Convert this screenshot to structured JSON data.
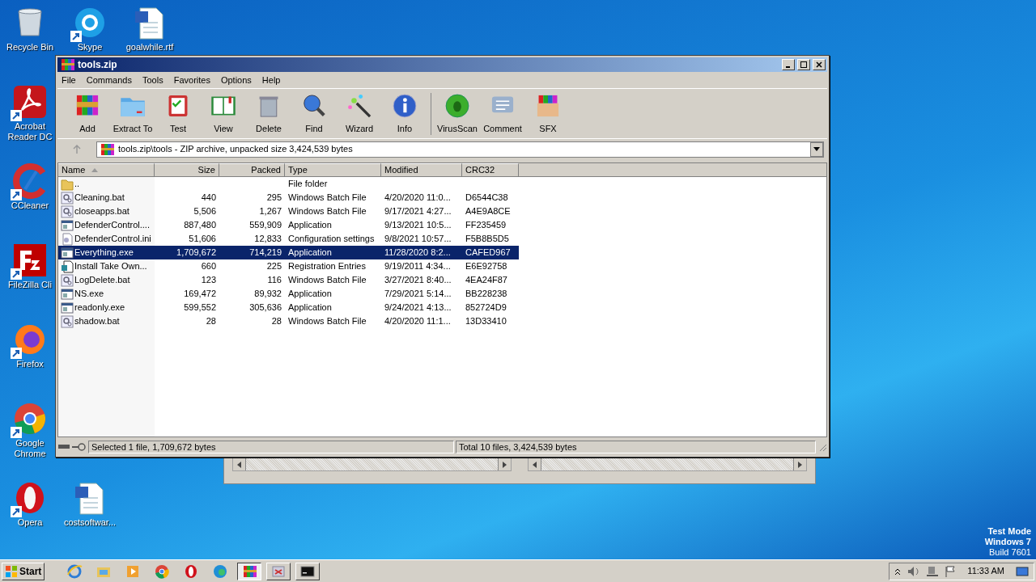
{
  "desktop_icons": [
    {
      "kind": "recycle",
      "label": "Recycle Bin",
      "shortcut": false
    },
    {
      "kind": "skype",
      "label": "Skype",
      "shortcut": true
    },
    {
      "kind": "word",
      "label": "goalwhile.rtf",
      "shortcut": false
    },
    {
      "kind": "acrobat",
      "label": "Acrobat Reader DC",
      "shortcut": true
    },
    {
      "kind": "ccleaner",
      "label": "CCleaner",
      "shortcut": true
    },
    {
      "kind": "filezilla",
      "label": "FileZilla Cli",
      "shortcut": true
    },
    {
      "kind": "firefox",
      "label": "Firefox",
      "shortcut": true
    },
    {
      "kind": "chrome",
      "label": "Google Chrome",
      "shortcut": true
    },
    {
      "kind": "opera",
      "label": "Opera",
      "shortcut": true
    },
    {
      "kind": "word",
      "label": "costsoftwar...",
      "shortcut": false
    }
  ],
  "window": {
    "title": "tools.zip",
    "menu": [
      "File",
      "Commands",
      "Tools",
      "Favorites",
      "Options",
      "Help"
    ],
    "toolbar": [
      {
        "kind": "add",
        "label": "Add"
      },
      {
        "kind": "extract",
        "label": "Extract To"
      },
      {
        "kind": "test",
        "label": "Test"
      },
      {
        "kind": "view",
        "label": "View"
      },
      {
        "kind": "delete",
        "label": "Delete"
      },
      {
        "kind": "find",
        "label": "Find"
      },
      {
        "kind": "wizard",
        "label": "Wizard"
      },
      {
        "kind": "info",
        "label": "Info"
      },
      {
        "kind": "virus",
        "label": "VirusScan"
      },
      {
        "kind": "comment",
        "label": "Comment"
      },
      {
        "kind": "sfx",
        "label": "SFX"
      }
    ],
    "address": "tools.zip\\tools - ZIP archive, unpacked size 3,424,539 bytes",
    "table": {
      "columns": [
        "Name",
        "Size",
        "Packed",
        "Type",
        "Modified",
        "CRC32"
      ],
      "rows": [
        {
          "kind": "folder",
          "name": "..",
          "size": "",
          "packed": "",
          "type": "File folder",
          "modified": "",
          "crc": "",
          "selected": false
        },
        {
          "kind": "bat",
          "name": "Cleaning.bat",
          "size": "440",
          "packed": "295",
          "type": "Windows Batch File",
          "modified": "4/20/2020 11:0...",
          "crc": "D6544C38",
          "selected": false
        },
        {
          "kind": "bat",
          "name": "closeapps.bat",
          "size": "5,506",
          "packed": "1,267",
          "type": "Windows Batch File",
          "modified": "9/17/2021 4:27...",
          "crc": "A4E9A8CE",
          "selected": false
        },
        {
          "kind": "exe",
          "name": "DefenderControl....",
          "size": "887,480",
          "packed": "559,909",
          "type": "Application",
          "modified": "9/13/2021 10:5...",
          "crc": "FF235459",
          "selected": false
        },
        {
          "kind": "ini",
          "name": "DefenderControl.ini",
          "size": "51,606",
          "packed": "12,833",
          "type": "Configuration settings",
          "modified": "9/8/2021 10:57...",
          "crc": "F5B8B5D5",
          "selected": false
        },
        {
          "kind": "exe",
          "name": "Everything.exe",
          "size": "1,709,672",
          "packed": "714,219",
          "type": "Application",
          "modified": "11/28/2020 8:2...",
          "crc": "CAFED967",
          "selected": true
        },
        {
          "kind": "reg",
          "name": "Install Take Own...",
          "size": "660",
          "packed": "225",
          "type": "Registration Entries",
          "modified": "9/19/2011 4:34...",
          "crc": "E6E92758",
          "selected": false
        },
        {
          "kind": "bat",
          "name": "LogDelete.bat",
          "size": "123",
          "packed": "116",
          "type": "Windows Batch File",
          "modified": "3/27/2021 8:40...",
          "crc": "4EA24F87",
          "selected": false
        },
        {
          "kind": "exe",
          "name": "NS.exe",
          "size": "169,472",
          "packed": "89,932",
          "type": "Application",
          "modified": "7/29/2021 5:14...",
          "crc": "BB228238",
          "selected": false
        },
        {
          "kind": "exe",
          "name": "readonly.exe",
          "size": "599,552",
          "packed": "305,636",
          "type": "Application",
          "modified": "9/24/2021 4:13...",
          "crc": "852724D9",
          "selected": false
        },
        {
          "kind": "bat",
          "name": "shadow.bat",
          "size": "28",
          "packed": "28",
          "type": "Windows Batch File",
          "modified": "4/20/2020 11:1...",
          "crc": "13D33410",
          "selected": false
        }
      ]
    },
    "status_bar": {
      "selection": "Selected 1 file, 1,709,672 bytes",
      "total": "Total 10 files, 3,424,539 bytes"
    }
  },
  "taskbar": {
    "start": "Start",
    "items": [
      {
        "kind": "ie",
        "selected": false
      },
      {
        "kind": "explorer",
        "selected": false
      },
      {
        "kind": "media",
        "selected": false
      },
      {
        "kind": "chrome",
        "selected": false
      },
      {
        "kind": "opera",
        "selected": false
      },
      {
        "kind": "edge",
        "selected": false
      },
      {
        "kind": "winrar",
        "selected": true
      },
      {
        "kind": "app",
        "selected": false
      },
      {
        "kind": "cmd",
        "selected": false
      }
    ],
    "clock": "11:33 AM"
  },
  "watermark_text": [
    "Test Mode",
    "Windows 7",
    "Build 7601"
  ]
}
